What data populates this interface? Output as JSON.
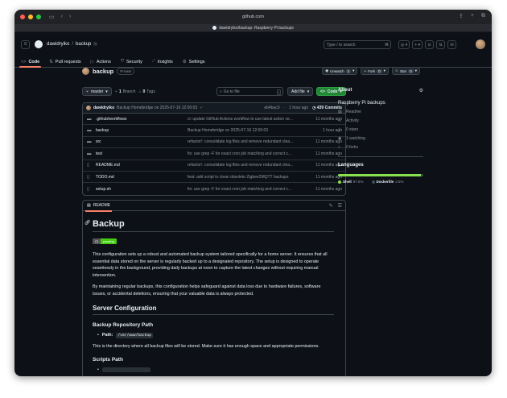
{
  "browser": {
    "url": "github.com",
    "tab_title": "dawidryiko/backup: Raspberry Pi backups",
    "dot_colors": [
      "#ff5f57",
      "#febc2e",
      "#28c840"
    ]
  },
  "header": {
    "owner": "dawidryiko",
    "separator": "/",
    "repo": "backup",
    "search_placeholder": "Type / to search",
    "search_key": "/"
  },
  "repo_nav": [
    {
      "label": "Code",
      "icon": "code-icon",
      "glyph": "<>",
      "active": true
    },
    {
      "label": "Pull requests",
      "icon": "pull-request-icon",
      "glyph": "⇅",
      "active": false
    },
    {
      "label": "Actions",
      "icon": "actions-icon",
      "glyph": "▷",
      "active": false
    },
    {
      "label": "Security",
      "icon": "shield-icon",
      "glyph": "⛉",
      "active": false
    },
    {
      "label": "Insights",
      "icon": "graph-icon",
      "glyph": "⟋",
      "active": false
    },
    {
      "label": "Settings",
      "icon": "gear-icon",
      "glyph": "⚙",
      "active": false
    }
  ],
  "repo": {
    "name": "backup",
    "visibility": "Private",
    "unwatch_label": "Unwatch",
    "unwatch_count": "1",
    "fork_label": "Fork",
    "fork_count": "0",
    "star_label": "Star",
    "star_count": "0"
  },
  "toolbar": {
    "branch": "master",
    "branches_count": "1",
    "branches_label": "Branch",
    "tags_count": "0",
    "tags_label": "Tags",
    "goto_placeholder": "Go to file",
    "goto_key": "t",
    "add_file_label": "Add file",
    "code_label": "Code"
  },
  "latest_commit": {
    "author": "dawidryiko",
    "message": "Backup Homebridge on 2025-07-16 12:00:03",
    "check": "✓",
    "hash": "eb4bac0",
    "time": "1 hour ago",
    "commits_count": "439 Commits"
  },
  "files": [
    {
      "type": "dir",
      "name": ".github/workflows",
      "message": "ci: update GitHub Actions workflow to use latest action ve...",
      "time": "11 months ago"
    },
    {
      "type": "dir",
      "name": "backup",
      "message": "Backup Homebridge on 2025-07-16 12:00:03",
      "time": "1 hour ago"
    },
    {
      "type": "dir",
      "name": "src",
      "message": "refactor!: consolidate log files and remove redundant clea...",
      "time": "11 months ago"
    },
    {
      "type": "dir",
      "name": "test",
      "message": "fix: use grep -F for exact cron job matching and correct c...",
      "time": "11 months ago"
    },
    {
      "type": "file",
      "name": "README.md",
      "message": "refactor!: consolidate log files and remove redundant clea...",
      "time": "11 months ago"
    },
    {
      "type": "file",
      "name": "TODO.md",
      "message": "feat: add script to clean obsolete Zigbee2MQTT backups",
      "time": "11 months ago"
    },
    {
      "type": "file",
      "name": "setup.sh",
      "message": "fix: use grep -F for exact cron job matching and correct c...",
      "time": "11 months ago"
    }
  ],
  "readme": {
    "tab_label": "README",
    "title": "Backup",
    "badge_left": "CI",
    "badge_right": "passing",
    "para1": "This configuration sets up a robust and automated backup system tailored specifically for a home server. It ensures that all essential data stored on the server is regularly backed up to a designated repository. The setup is designed to operate seamlessly in the background, providing daily backups at noon to capture the latest changes without requiring manual intervention.",
    "para2": "By maintaining regular backups, this configuration helps safeguard against data loss due to hardware failures, software issues, or accidental deletions, ensuring that your valuable data is always protected.",
    "h2_server": "Server Configuration",
    "h3_repo_path": "Backup Repository Path",
    "path_label": "Path:",
    "path_value": "/var/www/backup",
    "para3": "This is the directory where all backup files will be stored. Make sure it has enough space and appropriate permissions.",
    "h3_scripts": "Scripts Path"
  },
  "about": {
    "title": "About",
    "description": "Raspberry Pi backups",
    "stats": [
      {
        "icon": "book-icon",
        "glyph": "▤",
        "label": "Readme"
      },
      {
        "icon": "pulse-icon",
        "glyph": "∿",
        "label": "Activity"
      },
      {
        "icon": "star-icon",
        "glyph": "☆",
        "label": "0 stars"
      },
      {
        "icon": "eye-icon",
        "glyph": "◉",
        "label": "1 watching"
      },
      {
        "icon": "fork-icon",
        "glyph": "⑂",
        "label": "0 forks"
      }
    ],
    "languages_title": "Languages",
    "languages": [
      {
        "name": "Shell",
        "percent": "97.5%",
        "value": 97.5,
        "color": "#89e051"
      },
      {
        "name": "Dockerfile",
        "percent": "2.5%",
        "value": 2.5,
        "color": "#384d54"
      }
    ]
  }
}
